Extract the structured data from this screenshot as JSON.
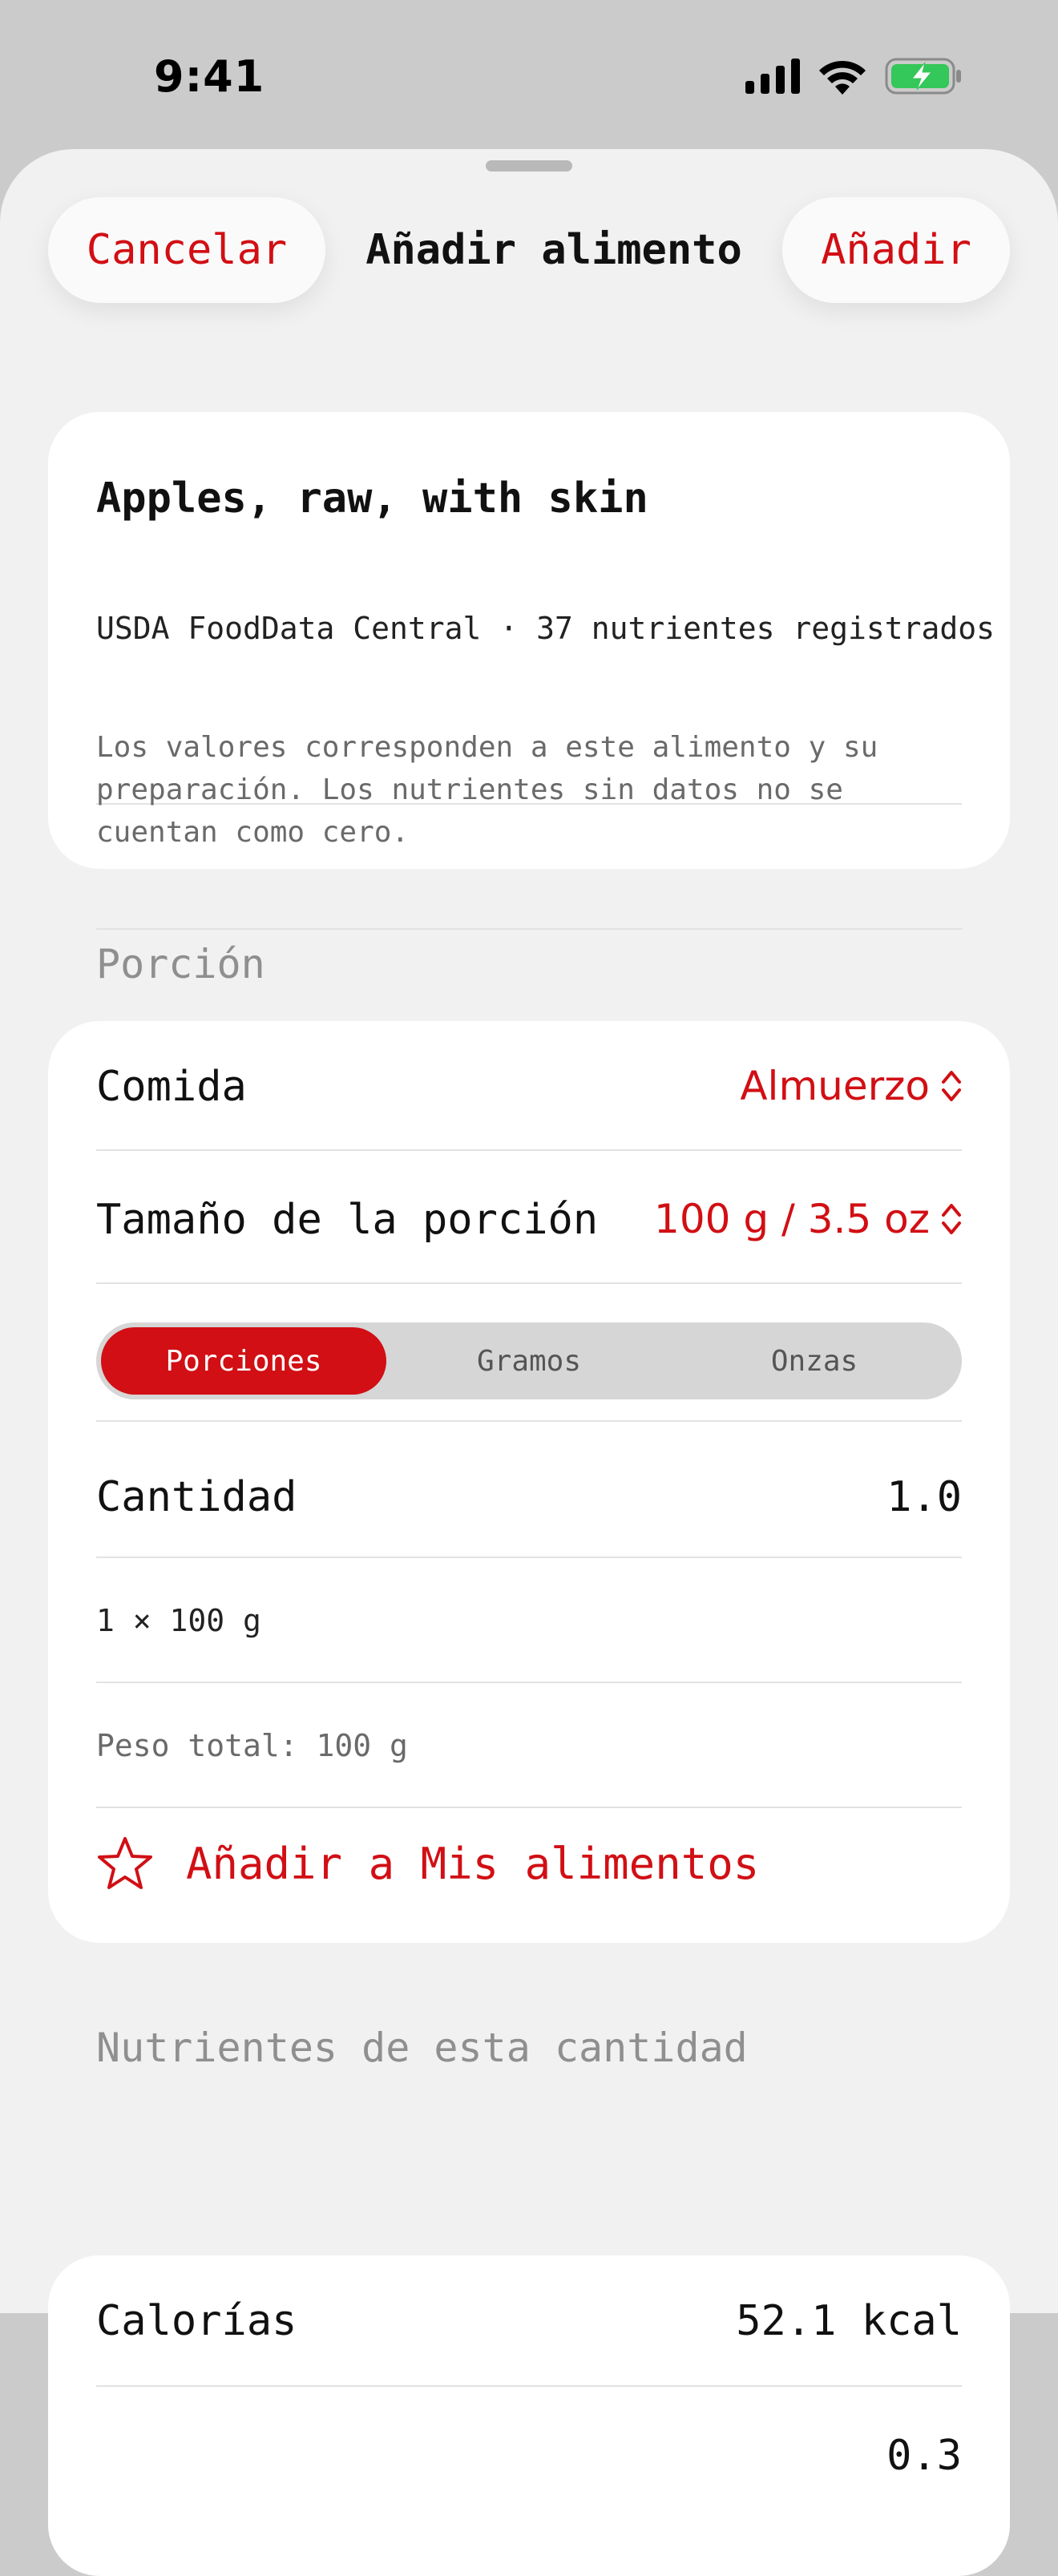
{
  "status_bar": {
    "time": "9:41",
    "icons": [
      "cellular-signal-icon",
      "wifi-icon",
      "battery-charging-icon"
    ]
  },
  "nav": {
    "cancel_label": "Cancelar",
    "title": "Añadir alimento",
    "add_label": "Añadir"
  },
  "food": {
    "name": "Apples, raw, with skin",
    "source": "USDA FoodData Central · 37 nutrientes registrados",
    "note": "Los valores corresponden a este alimento y su preparación. Los nutrientes sin datos no se cuentan como cero."
  },
  "portion": {
    "section_title": "Porción",
    "meal_label": "Comida",
    "meal_value": "Almuerzo",
    "size_label": "Tamaño de la porción",
    "size_value": "100 g / 3.5 oz",
    "segments": [
      "Porciones",
      "Gramos",
      "Onzas"
    ],
    "selected_segment": "Porciones",
    "quantity_label": "Cantidad",
    "quantity_value": "1.0",
    "formula": "1 × 100 g",
    "total_weight": "Peso total: 100 g",
    "favorite_label": "Añadir a Mis alimentos"
  },
  "nutrients": {
    "section_title": "Nutrientes de esta cantidad",
    "calories_label": "Calorías",
    "calories_value": "52.1 kcal",
    "next_value_partial": "0.3"
  },
  "colors": {
    "accent": "#d10f14",
    "background": "#f1f1f1",
    "card": "#ffffff",
    "battery": "#34c759"
  }
}
